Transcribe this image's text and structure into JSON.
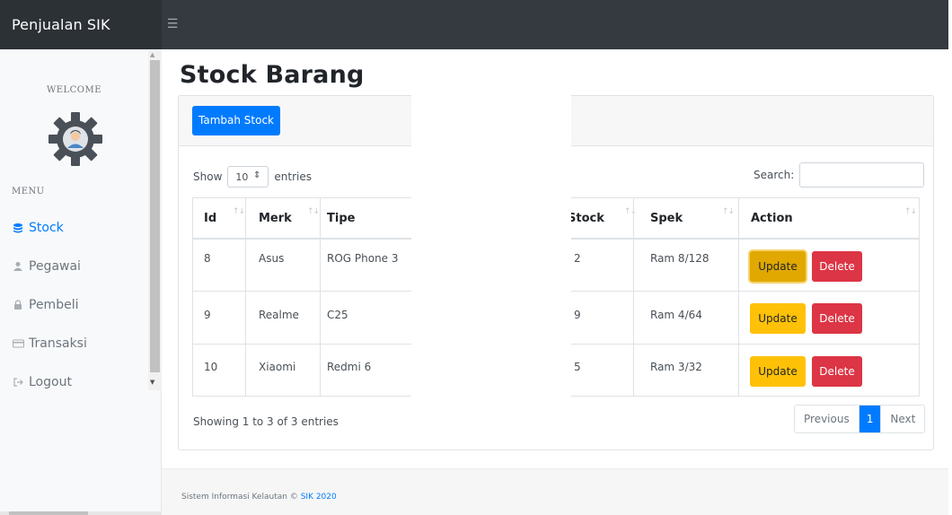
{
  "brand": {
    "title": "Penjualan SIK"
  },
  "sidebar": {
    "welcome": "WELCOME",
    "menu_label": "MENU",
    "items": [
      {
        "label": "Stock",
        "icon": "database-icon",
        "active": true
      },
      {
        "label": "Pegawai",
        "icon": "user-icon",
        "active": false
      },
      {
        "label": "Pembeli",
        "icon": "lock-icon",
        "active": false
      },
      {
        "label": "Transaksi",
        "icon": "card-icon",
        "active": false
      },
      {
        "label": "Logout",
        "icon": "logout-icon",
        "active": false
      }
    ]
  },
  "page": {
    "title": "Stock Barang"
  },
  "toolbar": {
    "add_label": "Tambah Stock"
  },
  "length": {
    "show_label": "Show",
    "value": "10",
    "entries_label": "entries"
  },
  "search": {
    "label": "Search:",
    "value": ""
  },
  "table": {
    "headers": [
      "Id",
      "Merk",
      "Tipe",
      "Stock",
      "Spek",
      "Action"
    ],
    "rows": [
      {
        "id": "8",
        "merk": "Asus",
        "tipe": "ROG Phone 3",
        "stock": "2",
        "spek": "Ram 8/128"
      },
      {
        "id": "9",
        "merk": "Realme",
        "tipe": "C25",
        "stock": "9",
        "spek": "Ram 4/64"
      },
      {
        "id": "10",
        "merk": "Xiaomi",
        "tipe": "Redmi 6",
        "stock": "5",
        "spek": "Ram 3/32"
      }
    ],
    "update_label": "Update",
    "delete_label": "Delete"
  },
  "info": "Showing 1 to 3 of 3 entries",
  "pagination": {
    "previous": "Previous",
    "current": "1",
    "next": "Next"
  },
  "footer": {
    "text": "Sistem Informasi Kelautan ©",
    "link": "SIK 2020"
  },
  "colors": {
    "primary": "#007bff",
    "warning": "#ffc107",
    "danger": "#dc3545",
    "topbar": "#343a40"
  }
}
